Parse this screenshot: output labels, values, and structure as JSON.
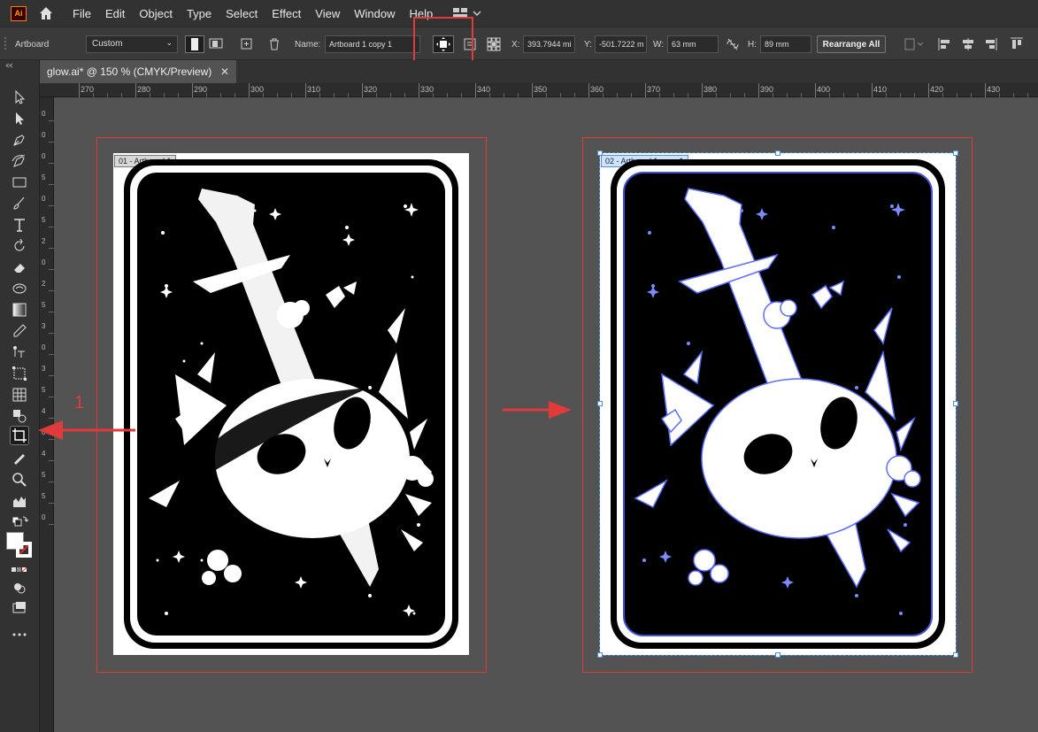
{
  "app": {
    "logo_text": "Ai"
  },
  "menu": [
    "File",
    "Edit",
    "Object",
    "Type",
    "Select",
    "Effect",
    "View",
    "Window",
    "Help"
  ],
  "control_bar": {
    "mode_label": "Artboard",
    "preset": "Custom",
    "name_label": "Name:",
    "name_value": "Artboard 1 copy 1",
    "x_label": "X:",
    "x_value": "393.7944 mi",
    "y_label": "Y:",
    "y_value": "-501.7222 m",
    "w_label": "W:",
    "w_value": "63 mm",
    "h_label": "H:",
    "h_value": "89 mm",
    "rearrange_label": "Rearrange All"
  },
  "document": {
    "tab_title": "glow.ai* @ 150 % (CMYK/Preview)",
    "close_symbol": "✕"
  },
  "ruler": {
    "h_ticks": [
      "270",
      "280",
      "290",
      "300",
      "310",
      "320",
      "330",
      "340",
      "350",
      "360",
      "370",
      "380",
      "390",
      "400",
      "410",
      "420",
      "430"
    ],
    "v_ticks": [
      "0",
      "0",
      "0",
      "5",
      "0",
      "5",
      "2",
      "0",
      "2",
      "5",
      "3",
      "0",
      "3",
      "5",
      "4",
      "0",
      "4",
      "5",
      "5",
      "0"
    ]
  },
  "artboards": [
    {
      "label": "01 - Artboard 1"
    },
    {
      "label": "02 - Artboard 1 copy 1"
    }
  ],
  "annotation": {
    "number": "1"
  },
  "colors": {
    "highlight": "#e03a3a",
    "selection": "#4a8fe0",
    "glow": "#6a7dff"
  }
}
